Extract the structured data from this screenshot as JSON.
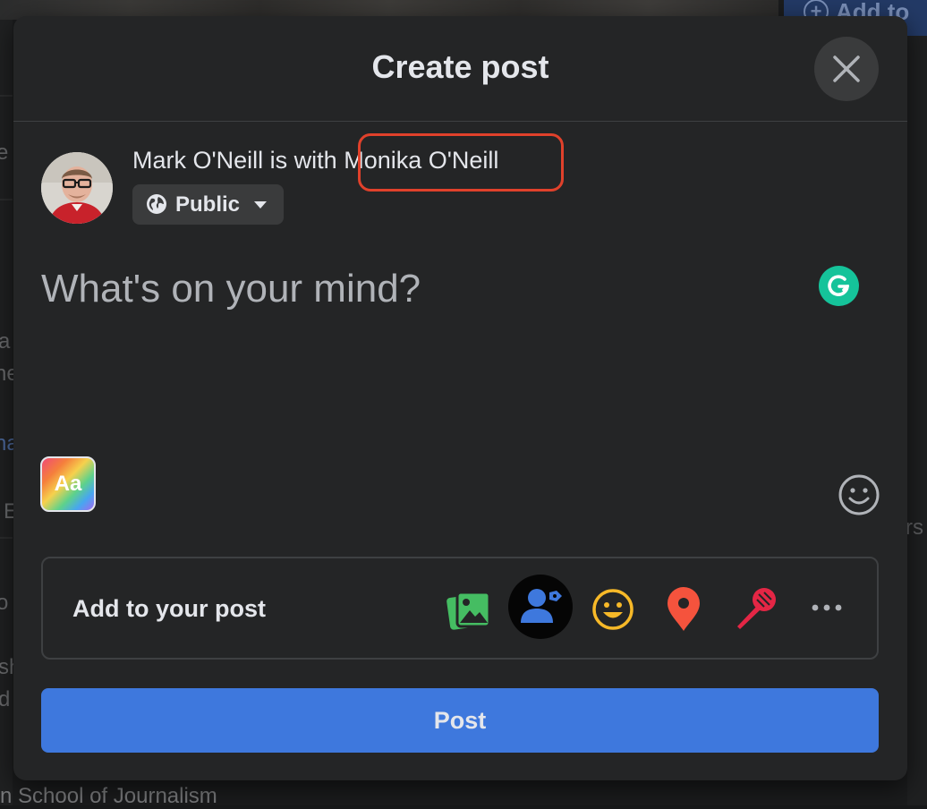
{
  "background": {
    "add_button_label": "Add to",
    "bottom_text": "n School of Journalism",
    "left_fragments": [
      "e",
      "a",
      "ne",
      "na",
      "E",
      "o",
      "sh",
      "d"
    ],
    "right_fragment": "rs"
  },
  "modal": {
    "title": "Create post",
    "author": {
      "name": "Mark O'Neill",
      "with_text": " is with ",
      "tagged_friend": "Monika O'Neill",
      "privacy_label": "Public"
    },
    "composer": {
      "placeholder": "What's on your mind?"
    },
    "text_style_label": "Aa",
    "add_to_post": {
      "label": "Add to your post",
      "icons": [
        "photo-video-icon",
        "tag-people-icon",
        "feeling-activity-icon",
        "check-in-icon",
        "live-audio-icon",
        "more-icon"
      ]
    },
    "post_button_label": "Post"
  },
  "colors": {
    "accent": "#3e78dd",
    "highlight": "#e0412b",
    "modal_bg": "#242526"
  }
}
